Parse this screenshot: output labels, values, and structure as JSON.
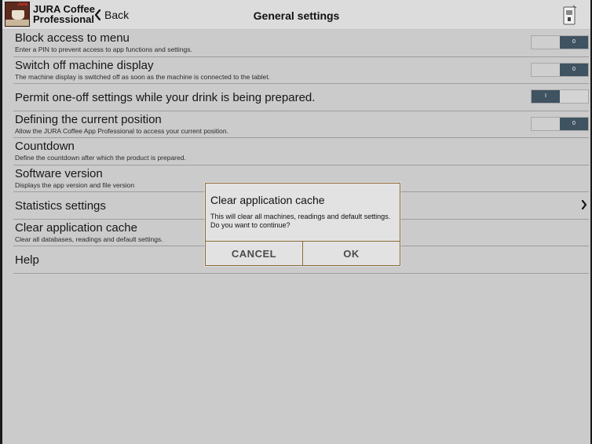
{
  "app": {
    "name": "JURA Coffee\nProfessional",
    "logo_brand": "Jura",
    "back_label": "Back",
    "title": "General settings"
  },
  "settings": [
    {
      "title": "Block access to menu",
      "subtitle": "Enter a PIN to prevent access to app functions and settings.",
      "toggle": "0",
      "state": "off"
    },
    {
      "title": "Switch off machine display",
      "subtitle": "The machine display is switched off as soon as the machine is connected to the tablet.",
      "toggle": "0",
      "state": "off"
    },
    {
      "title": "Permit one-off settings while your drink is being prepared.",
      "toggle": "I",
      "state": "on"
    },
    {
      "title": "Defining the current position",
      "subtitle": "Allow the JURA Coffee App Professional to access your current position.",
      "toggle": "0",
      "state": "off"
    },
    {
      "title": "Countdown",
      "subtitle": "Define the countdown after which the product is prepared."
    },
    {
      "title": "Software version",
      "subtitle": "Displays the app version and file version"
    },
    {
      "title": "Statistics settings"
    },
    {
      "title": "Clear application cache",
      "subtitle": "Clear all databases, readings and default settings."
    },
    {
      "title": "Help"
    }
  ],
  "dialog": {
    "title": "Clear application cache",
    "message": "This will clear all machines, readings and default settings. Do you want to continue?",
    "cancel_label": "CANCEL",
    "ok_label": "OK"
  },
  "colors": {
    "background": "#cbcbcb",
    "toggle_knob": "#3f5361",
    "dialog_border": "#8c6a38"
  }
}
